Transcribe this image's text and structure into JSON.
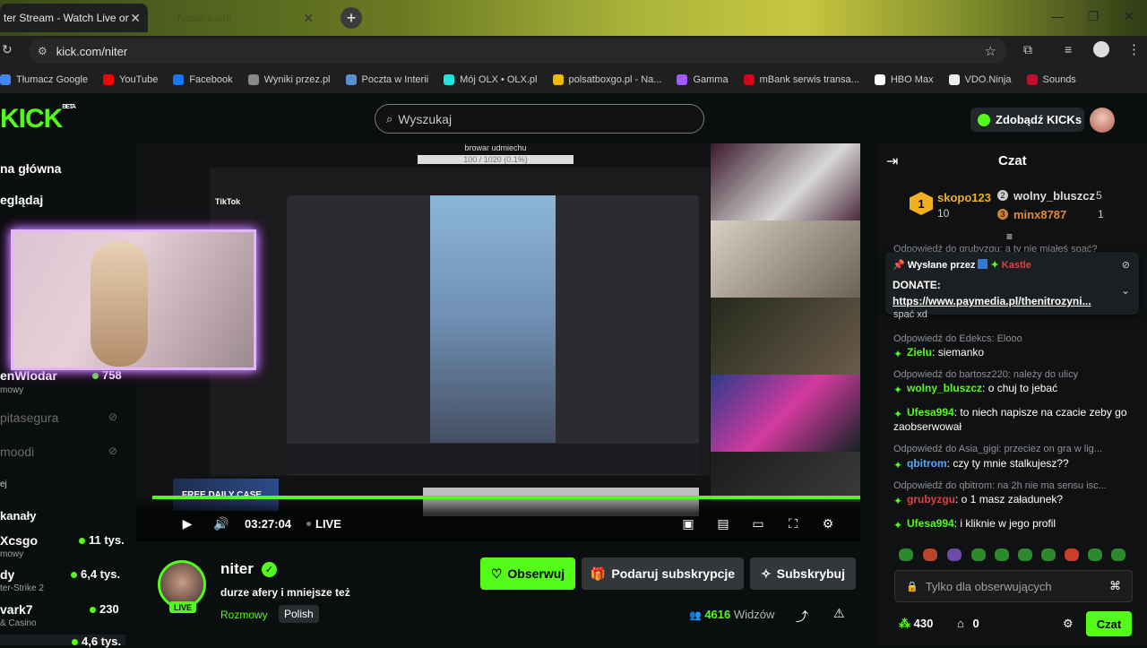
{
  "browser": {
    "tabs": [
      {
        "title": "ter Stream - Watch Live on Kick",
        "active": true
      },
      {
        "title": "Nowa karta",
        "active": false
      }
    ],
    "new_tab": "+",
    "url": "kick.com/niter",
    "window_controls": [
      "—",
      "❐",
      "✕"
    ],
    "bookmarks": [
      {
        "label": "Tłumacz Google",
        "icon": "translate-icon",
        "color": "#4285f4"
      },
      {
        "label": "YouTube",
        "icon": "youtube-icon",
        "color": "#ff0000"
      },
      {
        "label": "Facebook",
        "icon": "facebook-icon",
        "color": "#1877f2"
      },
      {
        "label": "Wyniki przez.pl",
        "icon": "web-icon",
        "color": "#888888"
      },
      {
        "label": "Poczta w Interii",
        "icon": "mail-icon",
        "color": "#5a8fd0"
      },
      {
        "label": "Mój OLX • OLX.pl",
        "icon": "olx-icon",
        "color": "#23e5db"
      },
      {
        "label": "polsatboxgo.pl - Na...",
        "icon": "polsat-icon",
        "color": "#f2b800"
      },
      {
        "label": "Gamma",
        "icon": "gamma-icon",
        "color": "#a259ff"
      },
      {
        "label": "mBank serwis transa...",
        "icon": "mbank-icon",
        "color": "#d6001c"
      },
      {
        "label": "HBO Max",
        "icon": "hbo-icon",
        "color": "#ffffff"
      },
      {
        "label": "VDO.Ninja",
        "icon": "ninja-icon",
        "color": "#eeeeee"
      },
      {
        "label": "Sounds",
        "icon": "sounds-icon",
        "color": "#c0102a"
      }
    ]
  },
  "kick": {
    "logo": "KICK",
    "logo_badge": "BETA",
    "search_placeholder": "Wyszukaj",
    "kicks_button": "Zdobądź KICKs",
    "accent": "#53fc18"
  },
  "sidebar": {
    "nav": [
      "na główna",
      "eglądaj"
    ],
    "channels_top": [
      {
        "name": "enWlodar",
        "sub": "mowy",
        "count": "758",
        "live": true
      },
      {
        "name": "pitasegura",
        "sub": "",
        "count": "",
        "live": false
      },
      {
        "name": "moodi",
        "sub": "",
        "count": "",
        "live": false
      }
    ],
    "section_fragment": "ej",
    "section_title": "kanały",
    "channels_bottom": [
      {
        "name": "Xcsgo",
        "sub": "mowy",
        "count": "11 tys."
      },
      {
        "name": "dy",
        "sub": "ter-Strike 2",
        "count": "6,4 tys."
      },
      {
        "name": "vark7",
        "sub": "& Casino",
        "count": "230"
      },
      {
        "name": "",
        "sub": "",
        "count": "4,6 tys."
      }
    ]
  },
  "player": {
    "overlay_title": "browar udmiechu",
    "overlay_progress": "100 / 1020 (0.1%)",
    "tiktok_label": "TikTok",
    "promo": "FREE DAILY CASE",
    "time": "03:27:04",
    "live_label": "LIVE"
  },
  "streamer": {
    "name": "niter",
    "title": "durze afery i mniejsze też",
    "category": "Rozmowy",
    "language": "Polish",
    "live_badge": "LIVE",
    "follow_button": "Obserwuj",
    "gift_button": "Podaruj subskrypcje",
    "subscribe_button": "Subskrybuj",
    "viewers": "4616",
    "viewers_label": "Widzów"
  },
  "chat": {
    "title": "Czat",
    "leaderboard": [
      {
        "rank": "1",
        "name": "skopo123",
        "count": "10"
      },
      {
        "rank": "2",
        "name": "wolny_bluszcz",
        "count": "5"
      },
      {
        "rank": "3",
        "name": "minx8787",
        "count": "1"
      }
    ],
    "pinned_top_fragment": "Odpowiedź do grubyzgu: a ty nie miałeś spać?",
    "pinned_by_label": "Wysłane przez",
    "pinned_by_user": "Kastle",
    "pinned_text_1": "DONATE:",
    "pinned_text_2": "https://www.paymedia.pl/thenitrozyni...",
    "hidden_fragment": "spać xd",
    "messages": [
      {
        "reply": "Odpowiedź do Edekcs: Elooo",
        "user": "",
        "text": ""
      },
      {
        "reply": "",
        "user": "Zielu",
        "text": "siemanko",
        "color": "#53fc18"
      },
      {
        "reply": "Odpowiedź do bartosz220: należy do ulicy",
        "user": "",
        "text": ""
      },
      {
        "reply": "",
        "user": "wolny_bluszcz",
        "text": "o chuj to jebać",
        "color": "#53fc18"
      },
      {
        "reply": "",
        "user": "Ufesa994",
        "text": "to niech napisze na czacie zeby go zaobserwował",
        "color": "#53fc18"
      },
      {
        "reply": "Odpowiedź do Asia_gigi: przeciez on gra w lig...",
        "user": "",
        "text": ""
      },
      {
        "reply": "",
        "user": "qbitrom",
        "text": "czy ty mnie stalkujesz??",
        "color": "#57a8ff"
      },
      {
        "reply": "Odpowiedź do qbitrom: na 2h nie ma sensu isc...",
        "user": "",
        "text": ""
      },
      {
        "reply": "",
        "user": "grubyzgu",
        "text": "o 1 masz załadunek?",
        "color": "#e04040"
      },
      {
        "reply": "",
        "user": "Ufesa994",
        "text": "i kliknie w jego profil",
        "color": "#53fc18"
      }
    ],
    "input_placeholder": "Tylko dla obserwujących",
    "points": "430",
    "store_count": "0",
    "send_button": "Czat"
  }
}
